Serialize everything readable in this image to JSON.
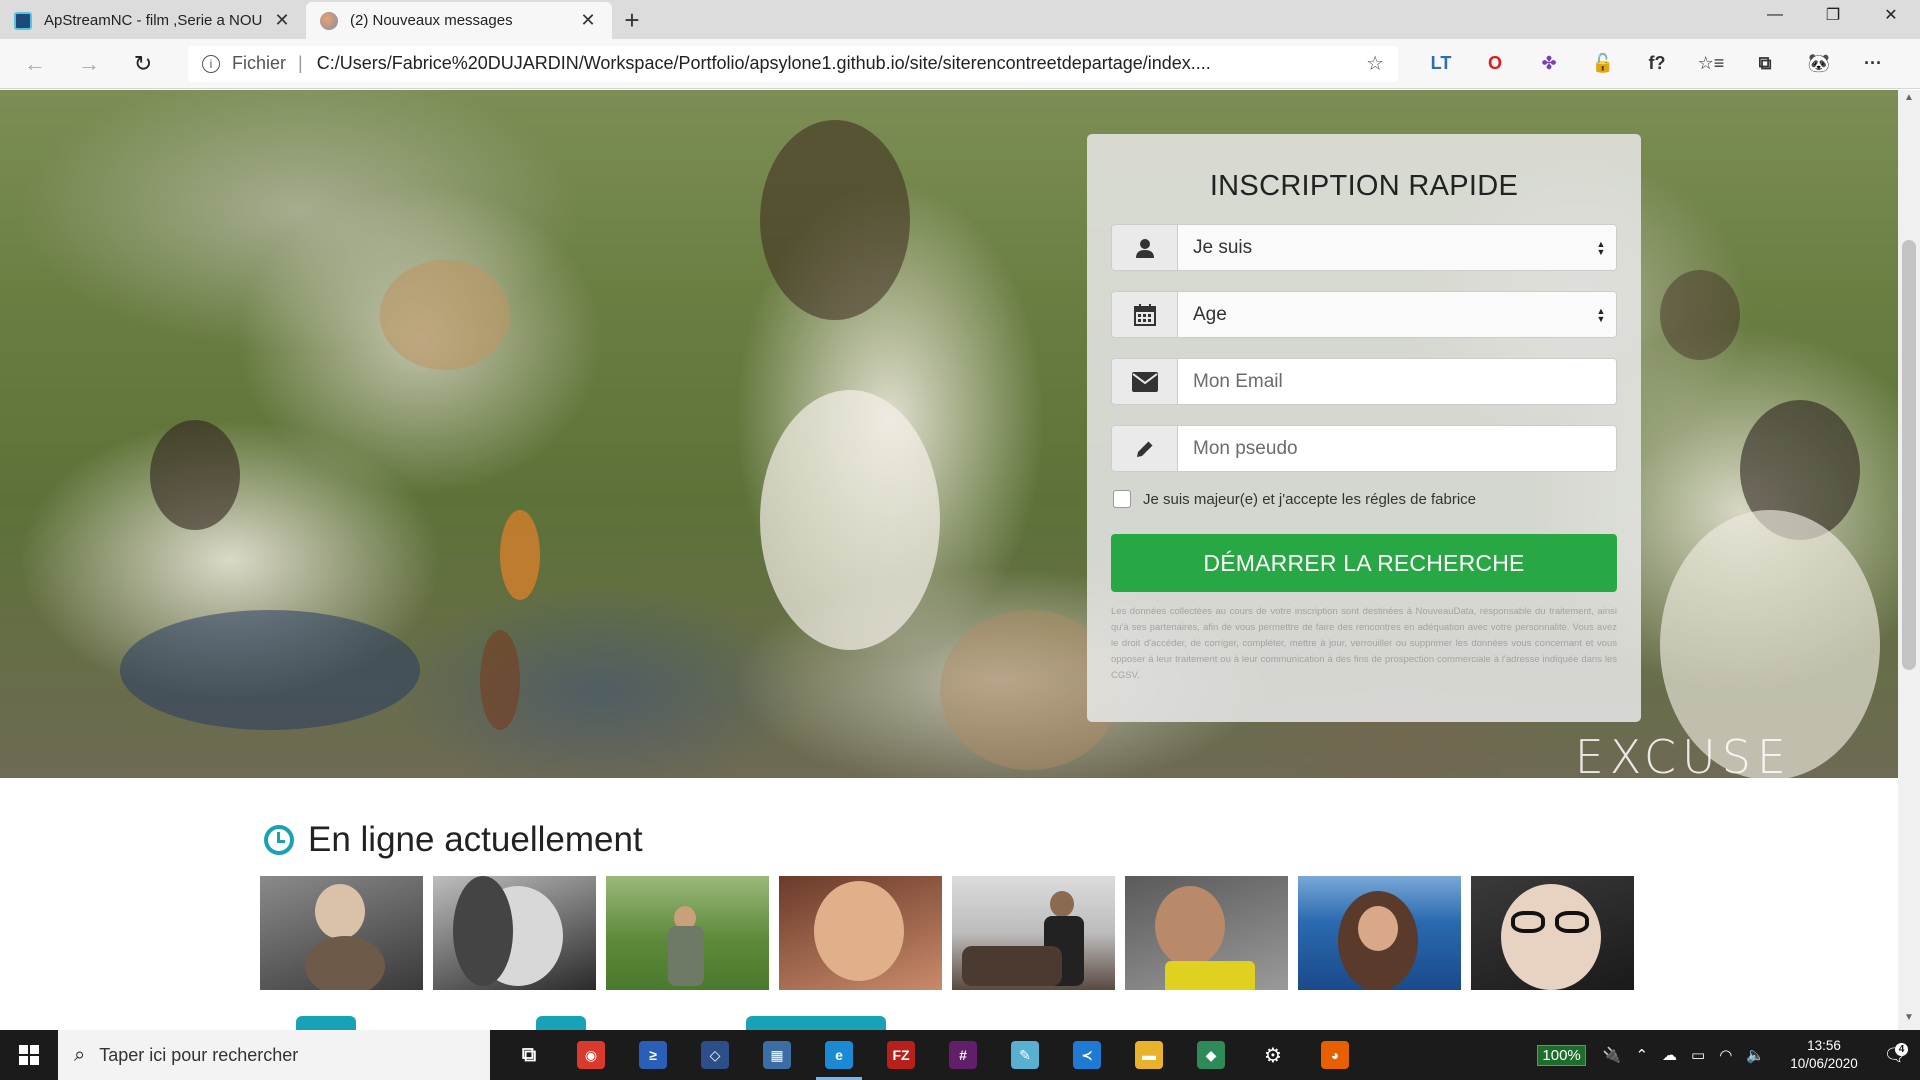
{
  "browser": {
    "tabs": [
      {
        "title": "ApStreamNC - film ,Serie a NOU",
        "close": "✕"
      },
      {
        "title": "(2) Nouveaux messages",
        "close": "✕"
      }
    ],
    "new_tab": "+",
    "window_controls": {
      "minimize": "—",
      "maximize": "❐",
      "close": "✕"
    },
    "back": "←",
    "forward": "→",
    "refresh": "↻",
    "info_icon": "i",
    "scheme_label": "Fichier",
    "separator": "|",
    "url": "C:/Users/Fabrice%20DUJARDIN/Workspace/Portfolio/apsylone1.github.io/site/siterencontreetdepartage/index....",
    "favorite_star": "☆",
    "extensions": [
      {
        "name": "lt-icon",
        "glyph": "LT",
        "color": "#2d6cb8"
      },
      {
        "name": "opera-icon",
        "glyph": "O",
        "color": "#e3161a"
      },
      {
        "name": "colorwheel-icon",
        "glyph": "✤",
        "color": "#7a3fb8"
      },
      {
        "name": "lock-extension-icon",
        "glyph": "🔓",
        "color": "#e05a2a"
      },
      {
        "name": "font-icon",
        "glyph": "f?",
        "color": "#333333"
      },
      {
        "name": "favorites-icon",
        "glyph": "☆≡",
        "color": "#333333"
      },
      {
        "name": "collections-icon",
        "glyph": "⧉",
        "color": "#333333"
      },
      {
        "name": "profile-avatar",
        "glyph": "🐼",
        "color": "#333333"
      },
      {
        "name": "menu-icon",
        "glyph": "···",
        "color": "#333333"
      }
    ]
  },
  "signup": {
    "title": "INSCRIPTION RAPIDE",
    "fields": [
      {
        "icon": "user-icon",
        "value": "Je suis",
        "type": "select"
      },
      {
        "icon": "calendar-icon",
        "value": "Age",
        "type": "select"
      },
      {
        "icon": "envelope-icon",
        "placeholder": "Mon Email",
        "type": "input"
      },
      {
        "icon": "pencil-icon",
        "placeholder": "Mon pseudo",
        "type": "input"
      }
    ],
    "checkbox_label": "Je suis majeur(e) et j'accepte les régles de fabrice",
    "submit_label": "DÉMARRER LA RECHERCHE",
    "legal_text": "Les données collectées au cours de votre inscription sont destinées à NouveauData, responsable du traitement, ainsi qu'à ses partenaires, afin de vous permettre de faire des rencontres en adéquation avec votre personnalité. Vous avez le droit d'accéder, de corriger, compléter, mettre à jour, verrouiller ou supprimer les données vous concernant et vous opposer à leur traitement ou à leur communication à des fins de prospection commerciale à l'adresse indiquée dans les CGSV."
  },
  "hero": {
    "watermark": "EXCUSE"
  },
  "online": {
    "title": "En ligne actuellement",
    "count": 8
  },
  "taskbar": {
    "search_placeholder": "Taper ici pour rechercher",
    "battery": "100%",
    "time": "13:56",
    "date": "10/06/2020",
    "notifications": "4",
    "apps": [
      {
        "name": "task-view-icon",
        "glyph": "⧉",
        "bg": "transparent"
      },
      {
        "name": "chrome-icon",
        "glyph": "◉",
        "bg": "#d93a2b"
      },
      {
        "name": "powershell-icon",
        "glyph": "≥",
        "bg": "#2a5fb8"
      },
      {
        "name": "network-app-icon",
        "glyph": "◇",
        "bg": "#2c4f8a"
      },
      {
        "name": "remote-desktop-icon",
        "glyph": "▦",
        "bg": "#3a6ea5"
      },
      {
        "name": "edge-icon",
        "glyph": "e",
        "bg": "#1a8ad4"
      },
      {
        "name": "filezilla-icon",
        "glyph": "FZ",
        "bg": "#b8201b"
      },
      {
        "name": "slack-icon",
        "glyph": "#",
        "bg": "#611f69"
      },
      {
        "name": "notepad-icon",
        "glyph": "✎",
        "bg": "#5ab0d0"
      },
      {
        "name": "vscode-icon",
        "glyph": "≺",
        "bg": "#1f7ad3"
      },
      {
        "name": "file-explorer-icon",
        "glyph": "▬",
        "bg": "#e8b22a"
      },
      {
        "name": "gitkraken-icon",
        "glyph": "◆",
        "bg": "#2e8b57"
      },
      {
        "name": "settings-icon",
        "glyph": "⚙",
        "bg": "transparent"
      },
      {
        "name": "firefox-icon",
        "glyph": "◕",
        "bg": "#e66000"
      }
    ]
  }
}
